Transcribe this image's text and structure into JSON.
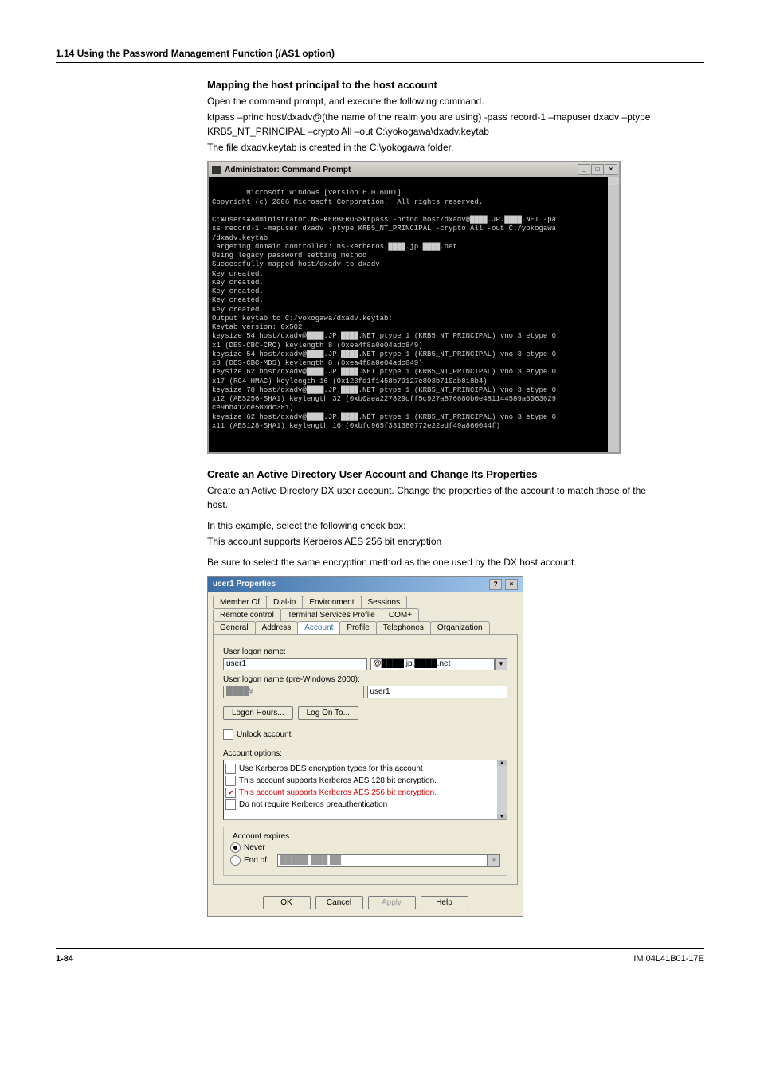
{
  "section_header": "1.14  Using the Password Management Function (/AS1 option)",
  "sub1": {
    "title": "Mapping the host principal to the host account",
    "p1": "Open the command prompt, and execute the following command.",
    "p2": "ktpass –princ host/dxadv@(the name of the realm you are using) -pass record-1 –mapuser dxadv –ptype KRB5_NT_PRINCIPAL –crypto All –out C:\\yokogawa\\dxadv.keytab",
    "p3": "The file dxadv.keytab is created in the C:\\yokogawa folder."
  },
  "cmd": {
    "title": "Administrator: Command Prompt",
    "text": "Microsoft Windows [Version 6.0.6001]\nCopyright (c) 2006 Microsoft Corporation.  All rights reserved.\n\nC:¥Users¥Administrator.NS-KERBEROS>ktpass -princ host/dxadv@████.JP.████.NET -pa\nss record-1 -mapuser dxadv -ptype KRB5_NT_PRINCIPAL -crypto All -out C:/yokogawa\n/dxadv.keytab\nTargeting domain controller: ns-kerberos.████.jp.████.net\nUsing legacy password setting method\nSuccessfully mapped host/dxadv to dxadv.\nKey created.\nKey created.\nKey created.\nKey created.\nKey created.\nOutput keytab to C:/yokogawa/dxadv.keytab:\nKeytab version: 0x502\nkeysize 54 host/dxadv@████.JP.████.NET ptype 1 (KRB5_NT_PRINCIPAL) vno 3 etype 0\nx1 (DES-CBC-CRC) keylength 8 (0xea4f8a0e04adc849)\nkeysize 54 host/dxadv@████.JP.████.NET ptype 1 (KRB5_NT_PRINCIPAL) vno 3 etype 0\nx3 (DES-CBC-MD5) keylength 8 (0xea4f8a0e04adc849)\nkeysize 62 host/dxadv@████.JP.████.NET ptype 1 (KRB5_NT_PRINCIPAL) vno 3 etype 0\nx17 (RC4-HMAC) keylength 16 (0x123fd1f1458b79127e803b710ab818b4)\nkeysize 78 host/dxadv@████.JP.████.NET ptype 1 (KRB5_NT_PRINCIPAL) vno 3 etype 0\nx12 (AES256-SHA1) keylength 32 (0xb0aea227829cff5c927a876680b0e481144589a0063629\nce9bb412ce580dc381)\nkeysize 62 host/dxadv@████.JP.████.NET ptype 1 (KRB5_NT_PRINCIPAL) vno 3 etype 0\nx11 (AES128-SHA1) keylength 16 (0xbfc965f331380772e22edf49a860044f)"
  },
  "sub2": {
    "title": "Create an Active Directory User Account and Change Its Properties",
    "p1": "Create an Active Directory DX user account. Change the properties of the account to match those of the host.",
    "p2": "In this example, select the following check box:",
    "p3": "This account supports Kerberos AES 256 bit encryption",
    "p4": "Be sure to select the same encryption method as the one used by the DX host account."
  },
  "dialog": {
    "title": "user1 Properties",
    "tabs_row1": [
      "Member Of",
      "Dial-in",
      "Environment",
      "Sessions"
    ],
    "tabs_row2": [
      "Remote control",
      "Terminal Services Profile",
      "COM+"
    ],
    "tabs_row3": [
      "General",
      "Address",
      "Account",
      "Profile",
      "Telephones",
      "Organization"
    ],
    "active_tab": "Account",
    "logon_label": "User logon name:",
    "logon_value": "user1",
    "realm_value": "@████.jp.████.net",
    "pre2000_label": "User logon name (pre-Windows 2000):",
    "pre2000_domain": "████¥",
    "pre2000_user": "user1",
    "btn_logon_hours": "Logon Hours...",
    "btn_log_on_to": "Log On To...",
    "unlock_label": "Unlock account",
    "acct_options_label": "Account options:",
    "options": [
      {
        "label": "Use Kerberos DES encryption types for this account",
        "checked": false
      },
      {
        "label": "This account supports Kerberos AES 128 bit encryption.",
        "checked": false
      },
      {
        "label": "This account supports Kerberos AES 256 bit encryption.",
        "checked": true
      },
      {
        "label": "Do not require Kerberos preauthentication",
        "checked": false
      }
    ],
    "expires_group": "Account expires",
    "never": "Never",
    "end_of": "End of:",
    "end_of_date": "█████ ███ ██",
    "buttons": {
      "ok": "OK",
      "cancel": "Cancel",
      "apply": "Apply",
      "help": "Help"
    }
  },
  "footer": {
    "page": "1-84",
    "doc": "IM 04L41B01-17E"
  }
}
